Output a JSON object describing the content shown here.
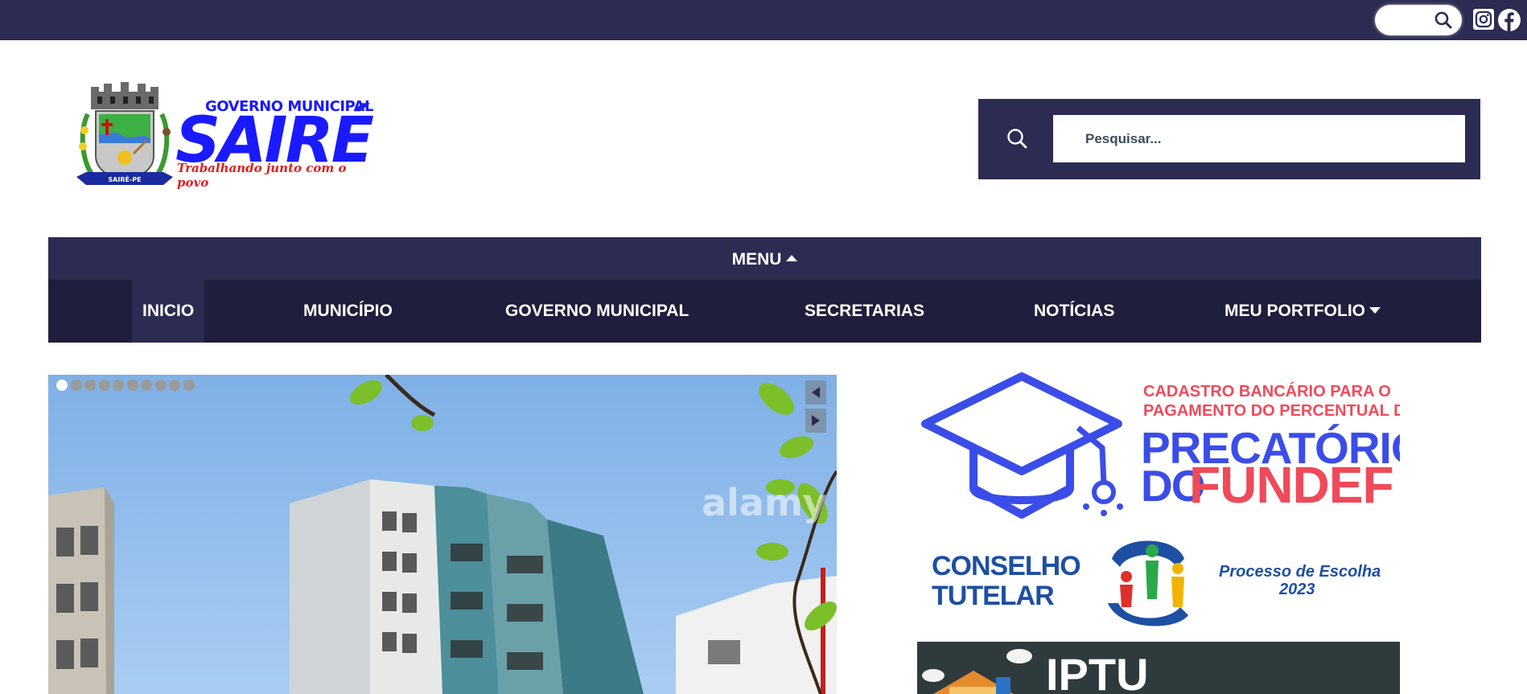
{
  "topbar": {
    "search_icon": "search-icon",
    "social": [
      {
        "name": "instagram-icon"
      },
      {
        "name": "facebook-icon"
      }
    ]
  },
  "logo": {
    "line1": "GOVERNO MUNICIPAL",
    "name": "SAIRÉ",
    "tagline": "Trabalhando junto com o povo",
    "seal_text": "SAIRÉ-PE"
  },
  "search": {
    "placeholder": "Pesquisar...",
    "icon": "search-icon"
  },
  "menu": {
    "toggle_label": "MENU",
    "items": [
      {
        "label": "INICIO",
        "active": true
      },
      {
        "label": "MUNICÍPIO"
      },
      {
        "label": "GOVERNO MUNICIPAL"
      },
      {
        "label": "SECRETARIAS"
      },
      {
        "label": "NOTÍCIAS"
      },
      {
        "label": "MEU PORTFOLIO",
        "has_dropdown": true
      }
    ]
  },
  "slider": {
    "slide_count": 10,
    "active_slide": 1,
    "watermark": "alamy"
  },
  "banners": {
    "fundef": {
      "line1": "CADASTRO BANCÁRIO PARA O",
      "line2": "PAGAMENTO DO PERCENTUAL DO",
      "precatorio": "PRECATÓRIO",
      "do": "DO",
      "fundef": "FUNDEF"
    },
    "conselho": {
      "line1": "CONSELHO",
      "line2": "TUTELAR",
      "process": "Processo de Escolha",
      "year": "2023"
    },
    "iptu": {
      "label": "IPTU"
    }
  },
  "colors": {
    "primary_navy": "#2c2b52",
    "nav_dark": "#1f1e3c",
    "brand_blue": "#1a1aff",
    "brand_red": "#e11d1d"
  }
}
